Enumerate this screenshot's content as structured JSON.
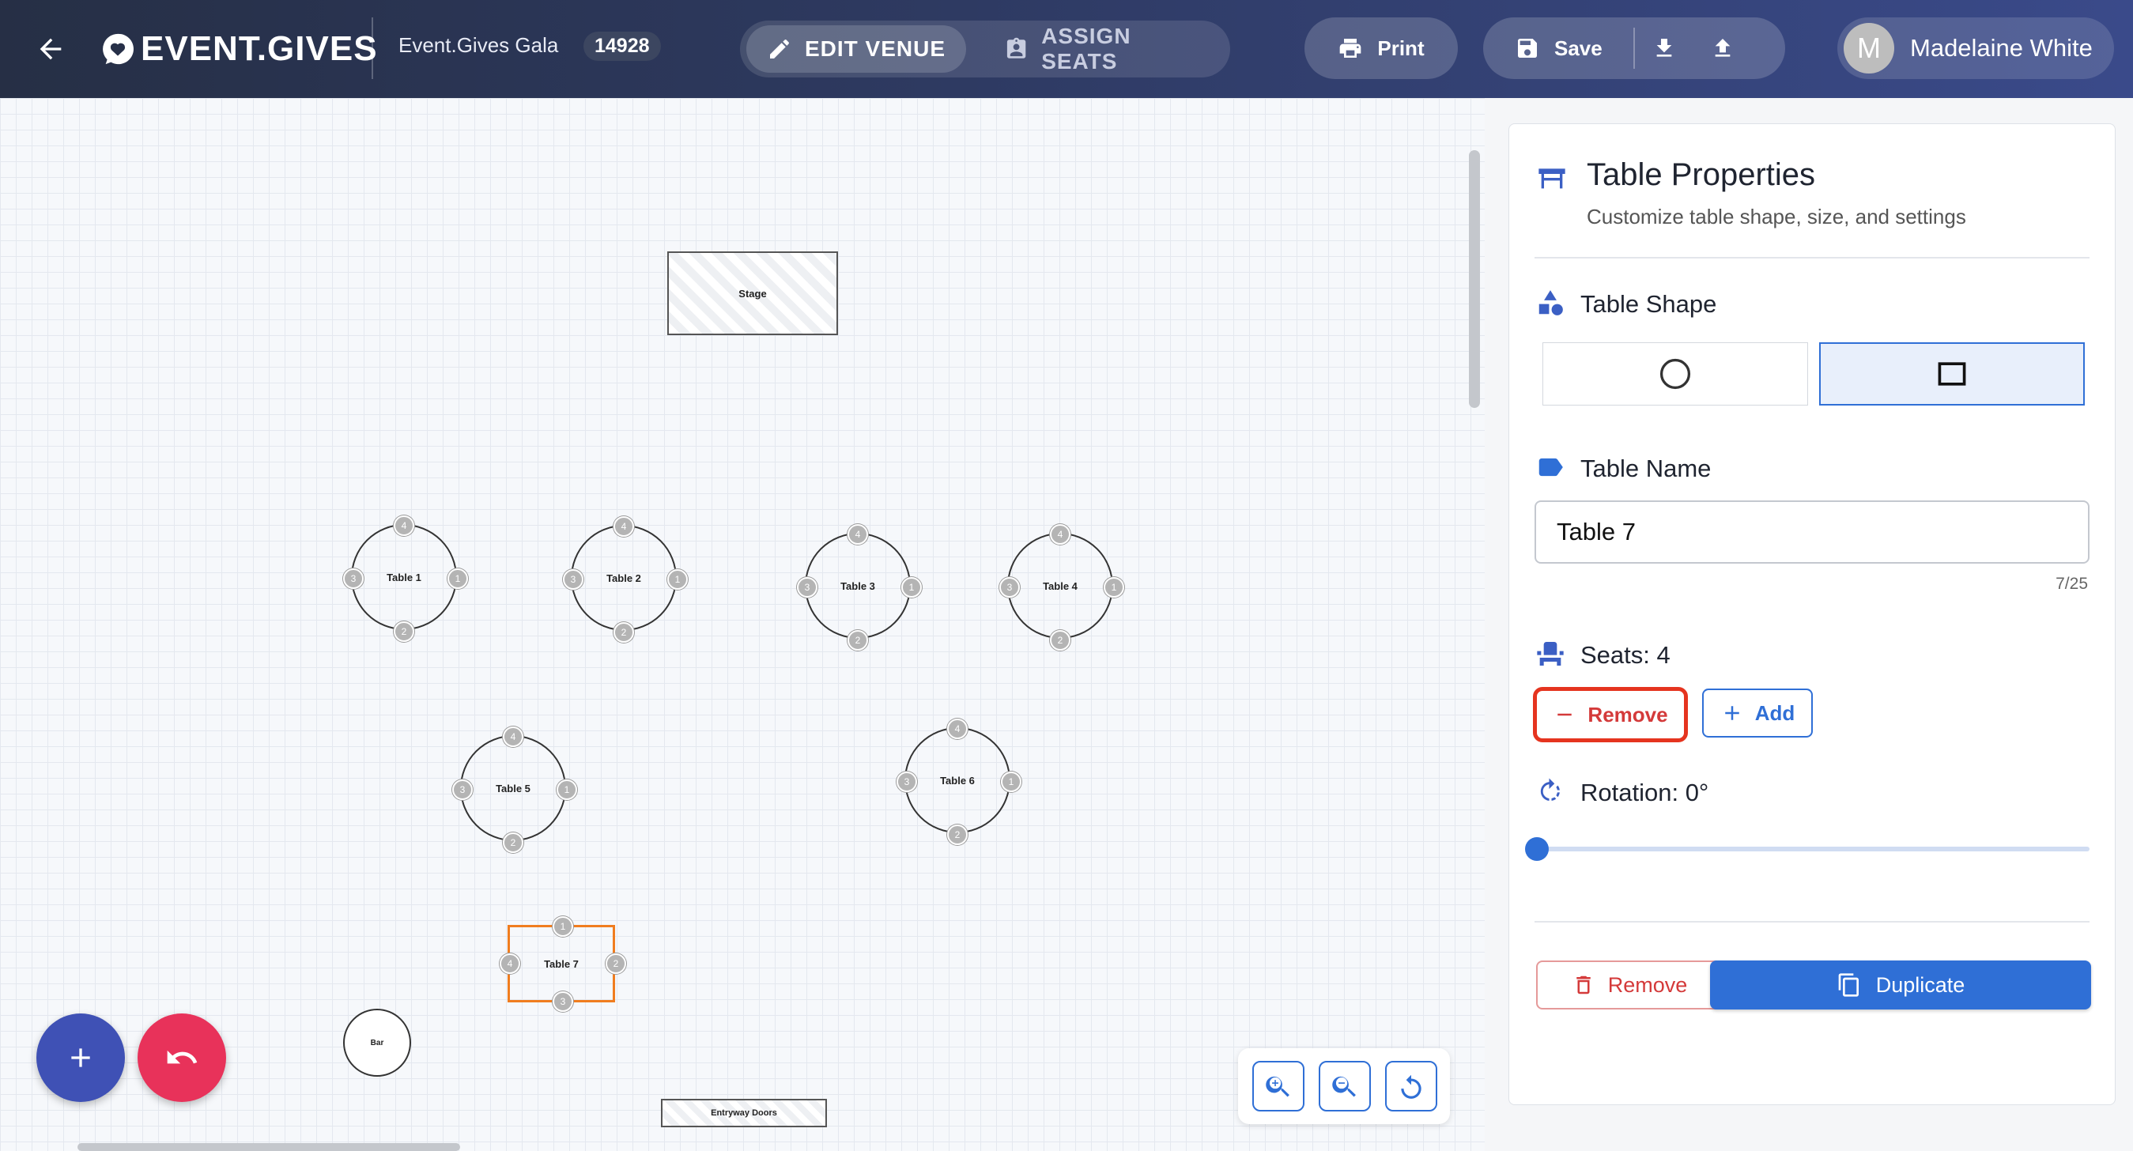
{
  "header": {
    "brand": "EVENT.GIVES",
    "event_name": "Event.Gives Gala",
    "event_id": "14928",
    "tabs": [
      {
        "label": "EDIT VENUE",
        "active": true
      },
      {
        "label": "ASSIGN SEATS",
        "active": false
      }
    ],
    "print_label": "Print",
    "save_label": "Save",
    "user": {
      "initial": "M",
      "name": "Madelaine White"
    }
  },
  "canvas": {
    "stage_label": "Stage",
    "entry_label": "Entryway Doors",
    "bar_label": "Bar",
    "tables": [
      {
        "name": "Table 1",
        "shape": "circle"
      },
      {
        "name": "Table 2",
        "shape": "circle"
      },
      {
        "name": "Table 3",
        "shape": "circle"
      },
      {
        "name": "Table 4",
        "shape": "circle"
      },
      {
        "name": "Table 5",
        "shape": "circle"
      },
      {
        "name": "Table 6",
        "shape": "circle"
      },
      {
        "name": "Table 7",
        "shape": "square",
        "selected": true
      }
    ],
    "seat_numbers": [
      "1",
      "2",
      "3",
      "4"
    ]
  },
  "panel": {
    "title": "Table Properties",
    "subtitle": "Customize table shape, size, and settings",
    "shape_label": "Table Shape",
    "shape_options": [
      "circle",
      "square"
    ],
    "selected_shape": "square",
    "name_label": "Table Name",
    "name_value": "Table 7",
    "name_counter": "7/25",
    "seats_label": "Seats: 4",
    "seat_remove_label": "Remove",
    "seat_add_label": "Add",
    "rotation_label": "Rotation: 0°",
    "rotation_value": 0,
    "remove_label": "Remove",
    "duplicate_label": "Duplicate"
  },
  "colors": {
    "accent": "#2f6fd6",
    "danger": "#d43a3a",
    "selected_table": "#f07d1f",
    "fab_add": "#3f51b5",
    "fab_undo": "#e8325a"
  }
}
